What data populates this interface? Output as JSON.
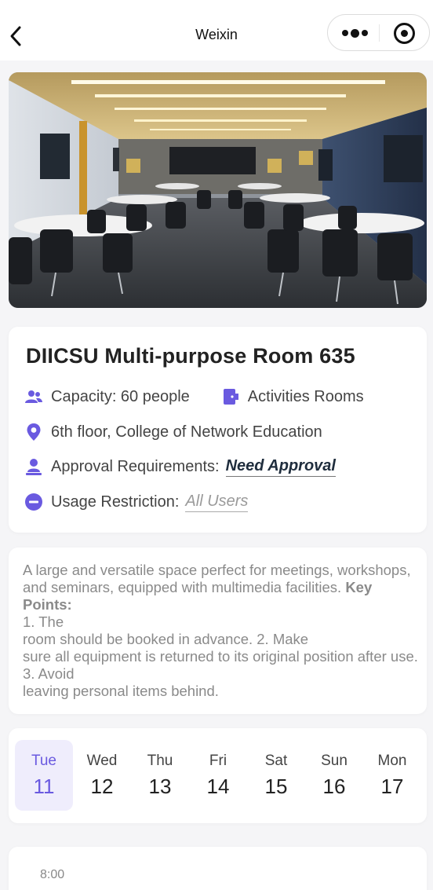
{
  "header": {
    "title": "Weixin",
    "back_icon": "back-arrow-icon",
    "menu_icon": "more-dots-icon",
    "close_icon": "target-circle-icon"
  },
  "room": {
    "name": "DIICSU Multi-purpose Room 635",
    "capacity": "Capacity: 60 people",
    "category": "Activities Rooms",
    "location": "6th floor, College of Network Education",
    "approval_label": "Approval Requirements:",
    "approval_value": "Need Approval",
    "restriction_label": "Usage Restriction:",
    "restriction_value": "All Users",
    "accent_color": "#6a5ae0"
  },
  "description": {
    "line1": "A large and versatile space perfect for meetings, workshops, and seminars, equipped with multimedia facilities.",
    "key_points_label": "Key Points:",
    "line2": "1. The",
    "line3": "room should be booked in advance. 2. Make",
    "line4": "sure all equipment is returned to its original position after use. 3. Avoid",
    "line5": "leaving personal items behind."
  },
  "calendar": {
    "selected_index": 0,
    "days": [
      {
        "name": "Tue",
        "num": "11"
      },
      {
        "name": "Wed",
        "num": "12"
      },
      {
        "name": "Thu",
        "num": "13"
      },
      {
        "name": "Fri",
        "num": "14"
      },
      {
        "name": "Sat",
        "num": "15"
      },
      {
        "name": "Sun",
        "num": "16"
      },
      {
        "name": "Mon",
        "num": "17"
      }
    ]
  },
  "schedule": {
    "first_time": "8:00"
  }
}
